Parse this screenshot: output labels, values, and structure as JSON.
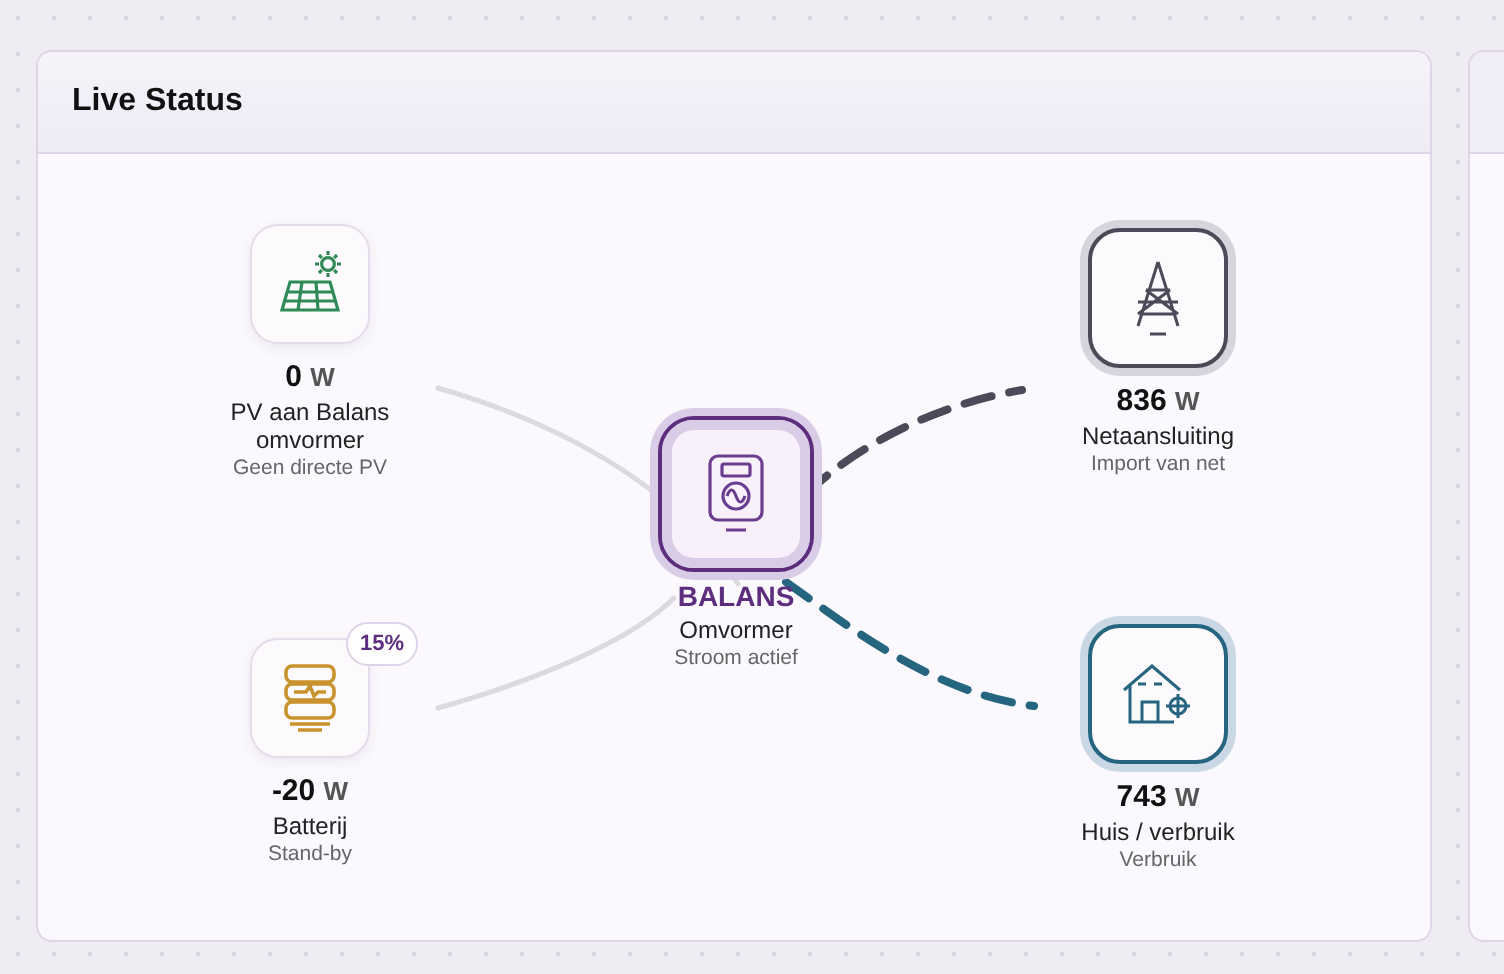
{
  "panel": {
    "title": "Live Status"
  },
  "flows": [
    {
      "kind": "solar",
      "active": false,
      "color": "#dcd9e0"
    },
    {
      "kind": "battery",
      "active": false,
      "color": "#dcd9e0"
    },
    {
      "kind": "grid",
      "active": true,
      "color": "#4a4a58"
    },
    {
      "kind": "house",
      "active": true,
      "color": "#26657f"
    }
  ],
  "nodes": [
    {
      "kind": "solar",
      "value": "0",
      "unit": "W",
      "label": "PV aan Balans omvormer",
      "sub": "Geen directe PV"
    },
    {
      "kind": "battery",
      "value": "-20",
      "unit": "W",
      "label": "Batterij",
      "sub": "Stand-by",
      "badge": "15%"
    },
    {
      "kind": "inverter",
      "name": "BALANS",
      "label": "Omvormer",
      "sub": "Stroom actief"
    },
    {
      "kind": "grid",
      "value": "836",
      "unit": "W",
      "label": "Netaansluiting",
      "sub": "Import van net"
    },
    {
      "kind": "house",
      "value": "743",
      "unit": "W",
      "label": "Huis / verbruik",
      "sub": "Verbruik"
    }
  ]
}
